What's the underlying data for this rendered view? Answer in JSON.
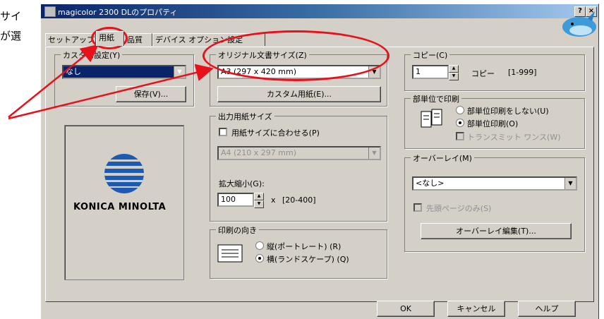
{
  "side_text": [
    "サイ",
    "が選"
  ],
  "window": {
    "title": "magicolor 2300 DLのプロパティ",
    "help_button": "?",
    "close_button": "×"
  },
  "tabs": [
    {
      "label": "セットアップ"
    },
    {
      "label": "用紙"
    },
    {
      "label": "品質"
    },
    {
      "label": "デバイス オプション設定"
    }
  ],
  "custom_settings": {
    "legend": "カスタム設定(Y)",
    "selected": "なし",
    "save_label": "保存(V)..."
  },
  "brand": {
    "logo_text": "KONICA MINOLTA"
  },
  "original_size": {
    "legend": "オリジナル文書サイズ(Z)",
    "selected": "A3 (297 x 420 mm)",
    "custom_paper_button": "カスタム用紙(E)..."
  },
  "output_size": {
    "legend": "出力用紙サイズ",
    "fit_checkbox_label": "用紙サイズに合わせる(P)",
    "selected": "A4 (210 x 297 mm)",
    "zoom_label": "拡大縮小(G):",
    "zoom_value": "100",
    "zoom_unit": "x",
    "zoom_range": "[20-400]"
  },
  "orientation": {
    "legend": "印刷の向き",
    "portrait_label": "縦(ポートレート) (R)",
    "landscape_label": "横(ランドスケープ) (Q)"
  },
  "copies": {
    "legend": "コピー(C)",
    "value": "1",
    "unit_label": "コピー",
    "range": "[1-999]"
  },
  "collate": {
    "legend": "部単位で印刷",
    "no_collate_label": "部単位印刷をしない(U)",
    "collate_label": "部単位印刷(O)",
    "transmit_label": "トランスミット ワンス(W)"
  },
  "overlay": {
    "legend": "オーバーレイ(M)",
    "selected": "<なし>",
    "first_page_label": "先頭ページのみ(S)",
    "edit_button": "オーバーレイ編集(T)..."
  },
  "footer": {
    "ok": "OK",
    "cancel": "キャンセル",
    "help": "ヘルプ"
  },
  "colors": {
    "annotation": "#e8101a",
    "titlebar": "#0a246a",
    "brand_blue": "#1c5bb4"
  }
}
